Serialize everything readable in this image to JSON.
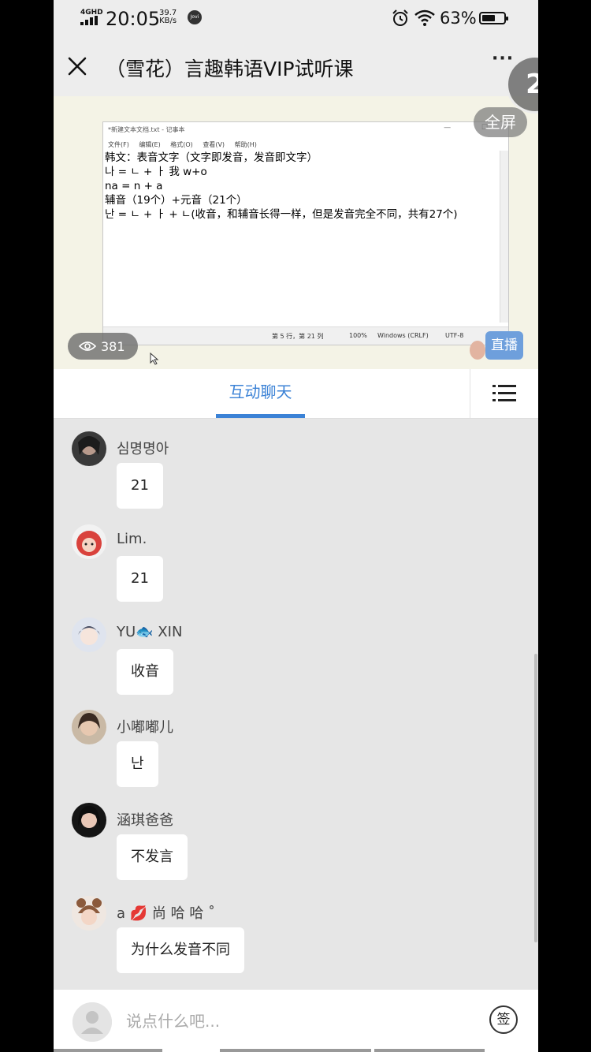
{
  "status": {
    "network": "4GHD",
    "time": "20:05",
    "speed_value": "39.7",
    "speed_unit": "KB/s",
    "assistant": "Jovi",
    "battery_pct": "63%",
    "battery_level": 0.63
  },
  "titlebar": {
    "title": "（雪花）言趣韩语VIP试听课",
    "more": "···"
  },
  "badge": "2",
  "video": {
    "fullscreen_label": "全屏",
    "viewers": "381",
    "live_label": "直播",
    "notepad": {
      "title": "*新建文本文档.txt - 记事本",
      "menu": [
        "文件(F)",
        "编辑(E)",
        "格式(O)",
        "查看(V)",
        "帮助(H)"
      ],
      "lines": [
        "韩文：表音文字（文字即发音，发音即文字）",
        "나 = ㄴ + ㅏ 我 w+o",
        "na = n + a",
        "辅音（19个）+元音（21个）",
        "난 = ㄴ + ㅏ + ㄴ(收音，和辅音长得一样，但是发音完全不同，共有27个)"
      ],
      "status_pos": "第 5 行，第 21 列",
      "status_zoom": "100%",
      "status_eol": "Windows (CRLF)",
      "status_enc": "UTF-8"
    }
  },
  "tabs": {
    "chat_label": "互动聊天"
  },
  "messages": [
    {
      "user": "심명명아",
      "text": "21"
    },
    {
      "user": "Lim.",
      "text": "21"
    },
    {
      "user": "YU🐟 XIN",
      "text": "收音"
    },
    {
      "user": "小嘟嘟儿",
      "text": "난"
    },
    {
      "user": "涵琪爸爸",
      "text": "不发言"
    },
    {
      "user": "a 💋 尚 哈 哈 ˚",
      "text": "为什么发音不同"
    }
  ],
  "input": {
    "placeholder": "说点什么吧...",
    "sign_label": "签"
  }
}
